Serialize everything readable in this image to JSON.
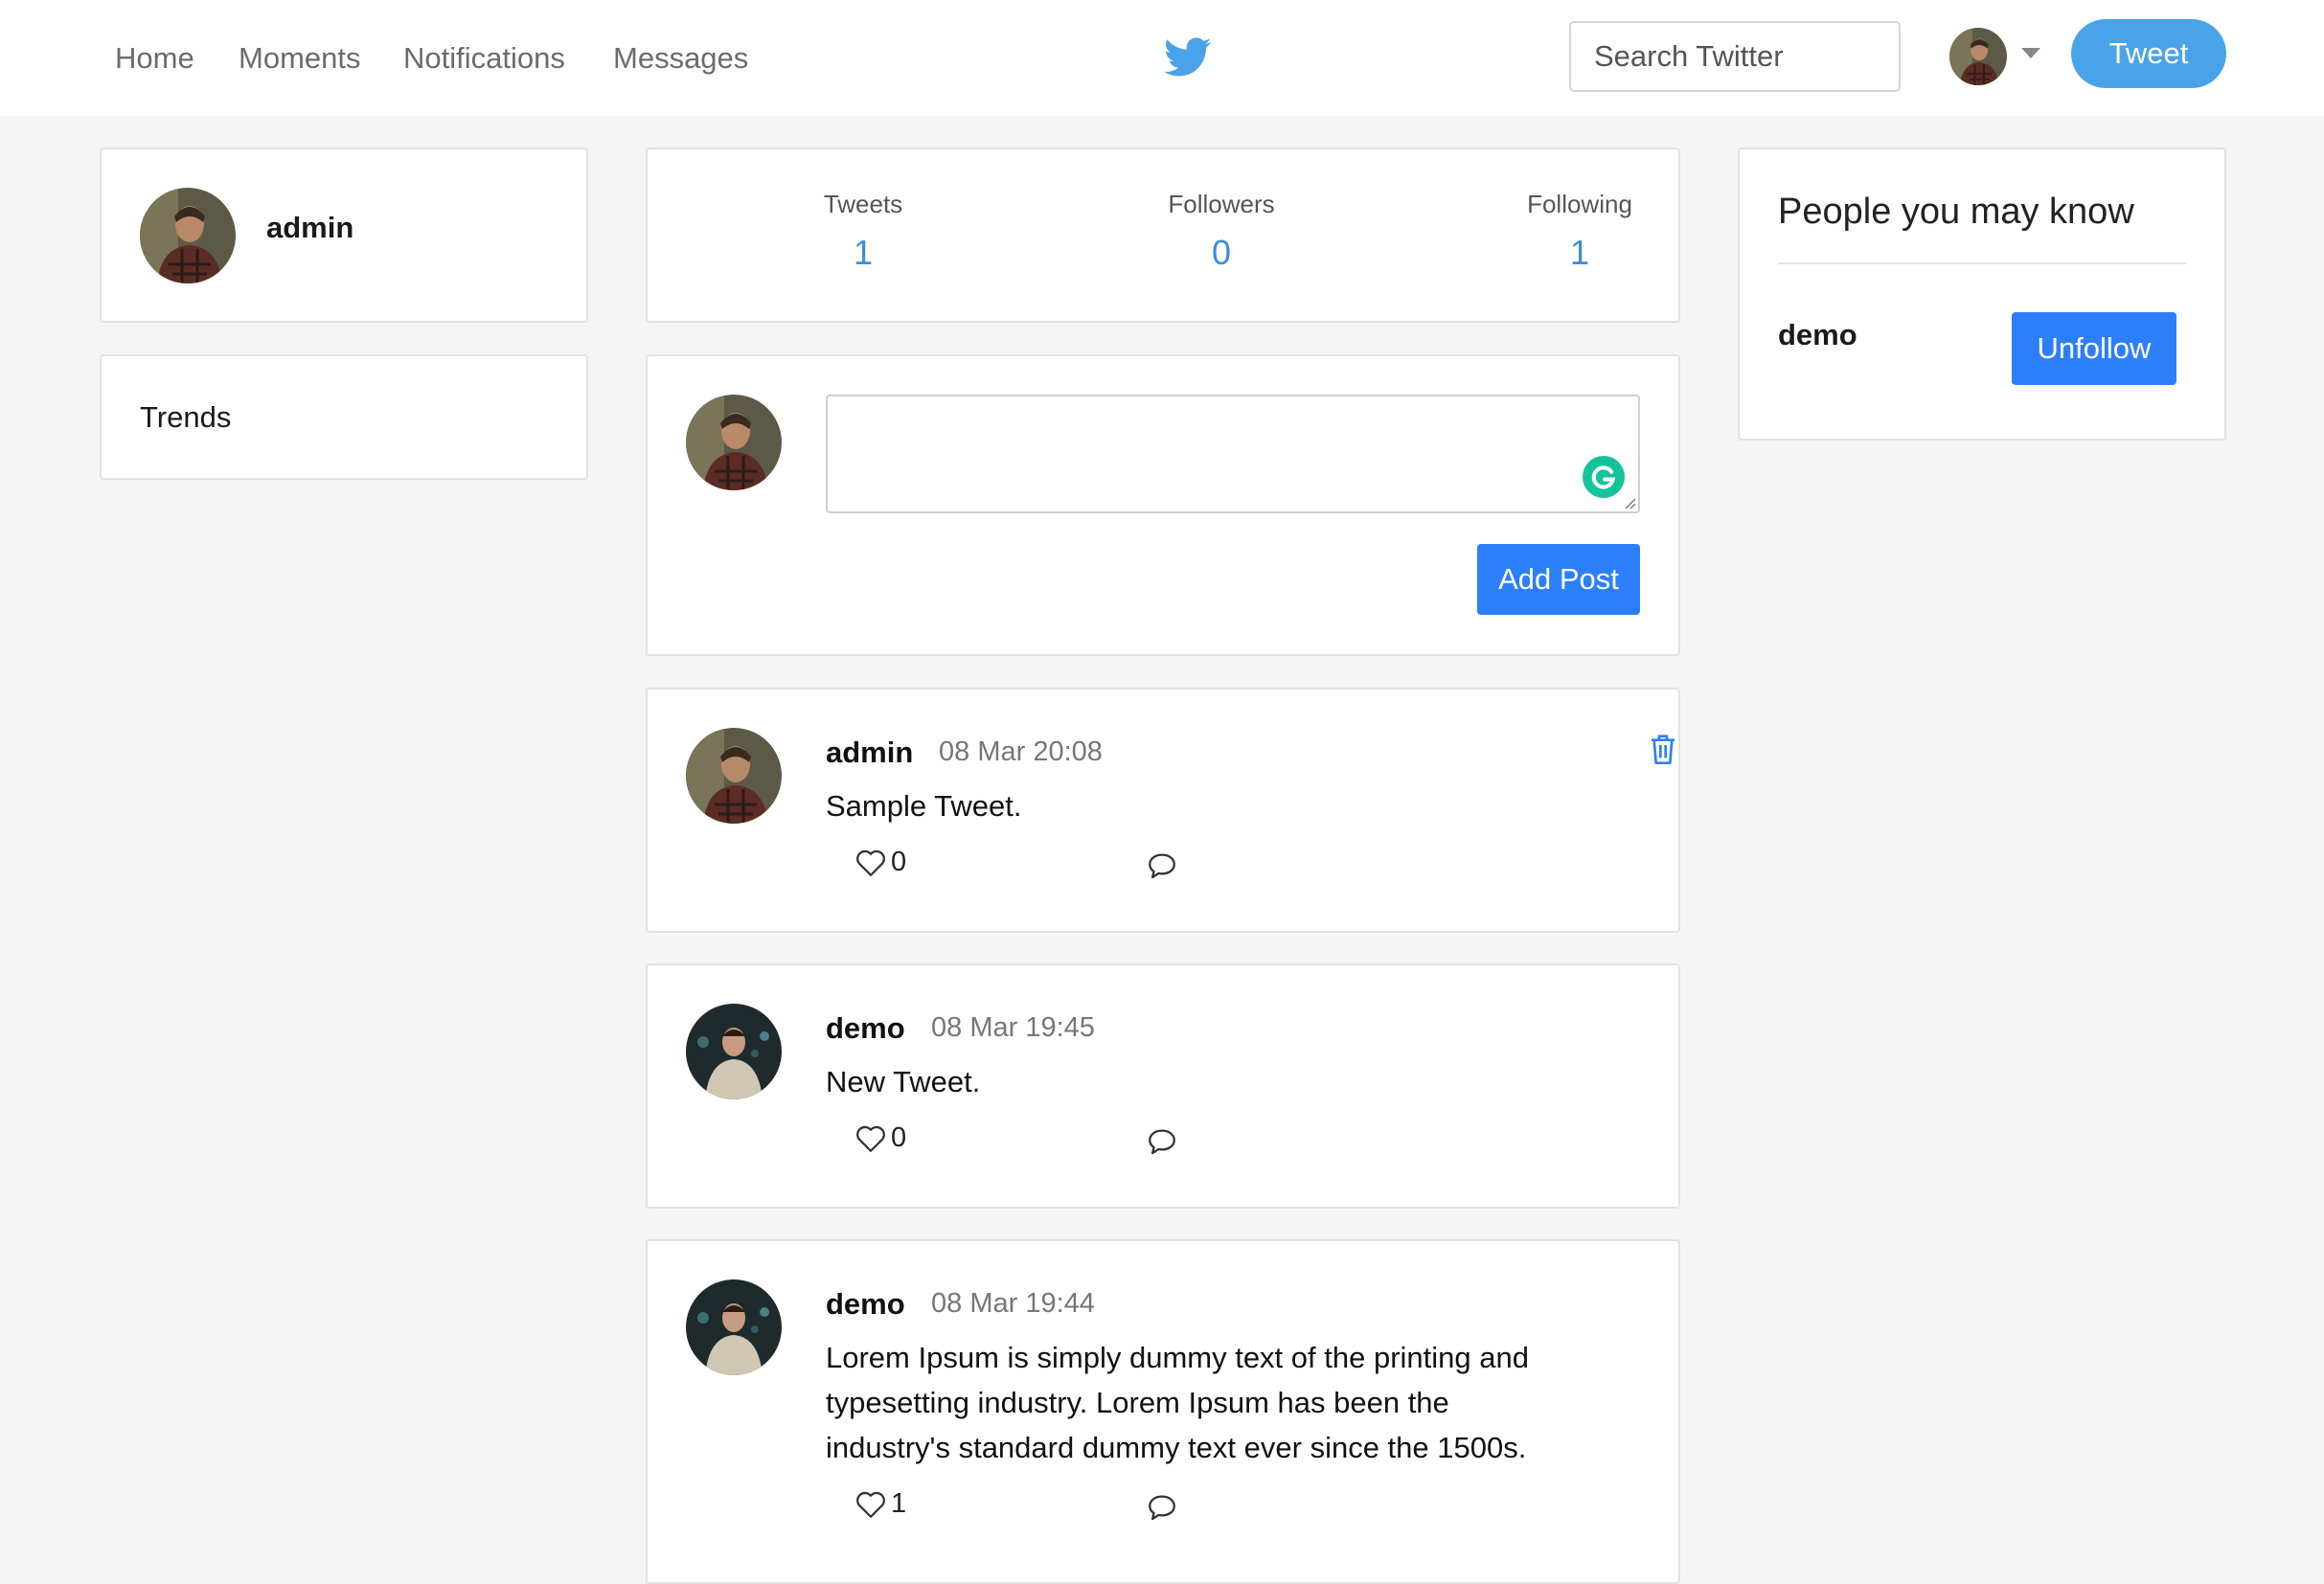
{
  "nav": {
    "links": [
      "Home",
      "Moments",
      "Notifications",
      "Messages"
    ],
    "search_placeholder": "Search Twitter",
    "tweet_button": "Tweet"
  },
  "profile": {
    "username": "admin"
  },
  "trends": {
    "title": "Trends"
  },
  "stats": [
    {
      "label": "Tweets",
      "value": "1"
    },
    {
      "label": "Followers",
      "value": "0"
    },
    {
      "label": "Following",
      "value": "1"
    }
  ],
  "composer": {
    "post_button": "Add Post"
  },
  "tweets": [
    {
      "name": "admin",
      "time": "08 Mar 20:08",
      "text": "Sample Tweet.",
      "likes": "0"
    },
    {
      "name": "demo",
      "time": "08 Mar 19:45",
      "text": "New Tweet.",
      "likes": "0"
    },
    {
      "name": "demo",
      "time": "08 Mar 19:44",
      "text": "Lorem Ipsum is simply dummy text of the printing and typesetting industry. Lorem Ipsum has been the industry's standard dummy text ever since the 1500s.",
      "likes": "1"
    }
  ],
  "suggestions": {
    "title": "People you may know",
    "people": [
      {
        "name": "demo",
        "button": "Unfollow"
      }
    ]
  },
  "colors": {
    "brand": "#4aa3e8",
    "primary_button": "#2d7ff9",
    "stat_value": "#3b8fd9"
  },
  "icons": [
    "twitter-bird-icon",
    "caret-down-icon",
    "trash-icon",
    "heart-icon",
    "comment-icon",
    "grammarly-icon"
  ]
}
